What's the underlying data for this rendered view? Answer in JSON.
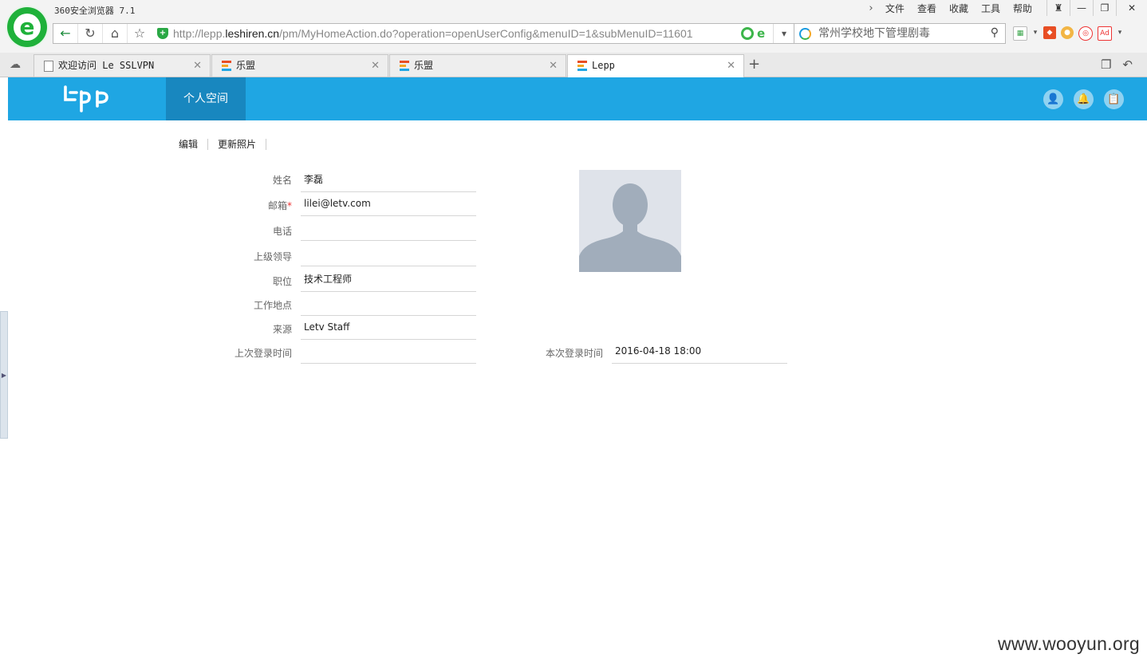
{
  "browser": {
    "app_title": "360安全浏览器 7.1",
    "menu": [
      "文件",
      "查看",
      "收藏",
      "工具",
      "帮助"
    ],
    "url_prefix": "http://lepp.",
    "url_host": "leshiren.cn",
    "url_path": "/pm/MyHomeAction.do?operation=openUserConfig&menuID=1&subMenuID=11601",
    "search_text": "常州学校地下管埋剧毒",
    "tabs": [
      {
        "label": "欢迎访问 Le SSLVPN",
        "icon": "page-icon"
      },
      {
        "label": "乐盟",
        "icon": "lepp-icon"
      },
      {
        "label": "乐盟",
        "icon": "lepp-icon"
      },
      {
        "label": "Lepp",
        "icon": "lepp-icon",
        "active": true
      }
    ]
  },
  "app": {
    "nav_tab": "个人空间",
    "actions": {
      "edit": "编辑",
      "update_photo": "更新照片"
    },
    "fields": {
      "name": {
        "label": "姓名",
        "value": "李磊"
      },
      "email": {
        "label": "邮箱",
        "required_mark": "*",
        "value": "lilei@letv.com"
      },
      "phone": {
        "label": "电话",
        "value": ""
      },
      "manager": {
        "label": "上级领导",
        "value": ""
      },
      "position": {
        "label": "职位",
        "value": "技术工程师"
      },
      "location": {
        "label": "工作地点",
        "value": ""
      },
      "source": {
        "label": "来源",
        "value": "Letv Staff"
      },
      "last_login": {
        "label": "上次登录时间",
        "value": ""
      },
      "current_login": {
        "label": "本次登录时间",
        "value": "2016-04-18 18:00"
      }
    },
    "colors": {
      "accent": "#1fa6e3",
      "nav_active": "#1887bf"
    }
  },
  "watermark": "www.wooyun.org"
}
